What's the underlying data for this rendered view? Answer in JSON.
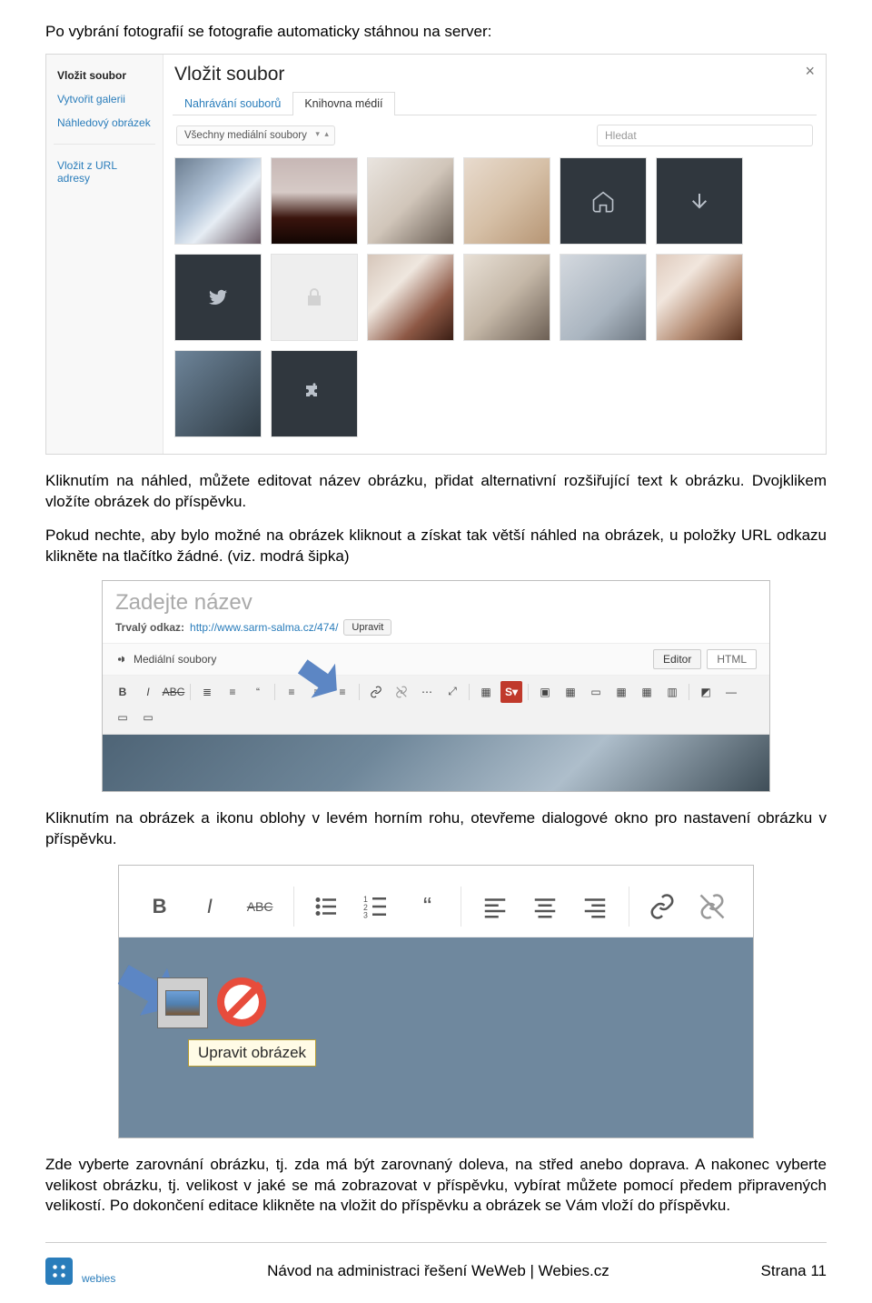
{
  "intro": "Po vybrání fotografií se fotografie automaticky stáhnou na server:",
  "modal": {
    "title": "Vložit soubor",
    "sidebar": {
      "vlozit": "Vložit soubor",
      "galerie": "Vytvořit galerii",
      "nahledovy": "Náhledový obrázek",
      "url": "Vložit z URL adresy"
    },
    "tabs": {
      "upload": "Nahrávání souborů",
      "library": "Knihovna médií"
    },
    "filter_label": "Všechny mediální soubory",
    "search_placeholder": "Hledat"
  },
  "para1": "Kliknutím na náhled, můžete editovat název obrázku, přidat alternativní rozšiřující text k obrázku. Dvojklikem vložíte obrázek do příspěvku.",
  "para2": "Pokud nechte, aby bylo možné na obrázek kliknout a získat tak větší náhled na obrázek, u položky URL odkazu klikněte na tlačítko žádné. (viz. modrá šipka)",
  "editor": {
    "title_placeholder": "Zadejte název",
    "permalink_prefix": "Trvalý odkaz:",
    "permalink_url": "http://www.sarm-salma.cz/474/",
    "permalink_edit": "Upravit",
    "media_btn": "Mediální soubory",
    "mode_visual": "Editor",
    "mode_html": "HTML"
  },
  "para3": "Kliknutím na obrázek a ikonu oblohy v levém horním rohu, otevřeme dialogové okno pro nastavení obrázku v příspěvku.",
  "imgedit": {
    "tooltip": "Upravit obrázek"
  },
  "para4": "Zde vyberte zarovnání obrázku, tj. zda má být zarovnaný doleva, na střed anebo doprava. A nakonec vyberte velikost obrázku, tj. velikost v jaké se má zobrazovat v příspěvku, vybírat můžete pomocí předem připravených velikostí. Po dokončení editace klikněte na vložit do příspěvku a obrázek se Vám vloží do příspěvku.",
  "footer": {
    "brand": "webies",
    "center": "Návod na administraci řešení WeWeb | Webies.cz",
    "page": "Strana 11"
  }
}
